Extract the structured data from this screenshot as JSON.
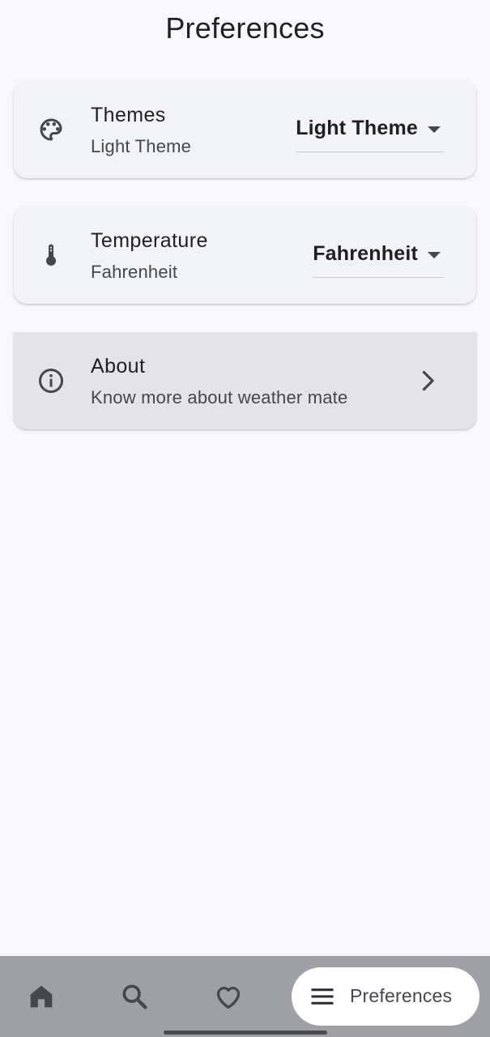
{
  "header": {
    "title": "Preferences"
  },
  "settings": {
    "themes": {
      "title": "Themes",
      "subtitle": "Light Theme",
      "selected": "Light Theme",
      "icon": "palette-icon"
    },
    "temperature": {
      "title": "Temperature",
      "subtitle": "Fahrenheit",
      "selected": "Fahrenheit",
      "icon": "thermometer-icon"
    },
    "about": {
      "title": "About",
      "subtitle": "Know more about weather mate",
      "icon": "info-icon"
    }
  },
  "bottom_nav": {
    "items": [
      {
        "icon": "home-icon"
      },
      {
        "icon": "search-icon"
      },
      {
        "icon": "heart-icon"
      },
      {
        "icon": "menu-icon",
        "label": "Preferences",
        "active": true
      }
    ]
  },
  "colors": {
    "background": "#f8f7fe",
    "card": "#f2f3f7",
    "card_pressed": "#e4e3e8",
    "nav_bar": "#9fa0a7",
    "nav_active": "#ffffff",
    "icon": "#46464f"
  }
}
